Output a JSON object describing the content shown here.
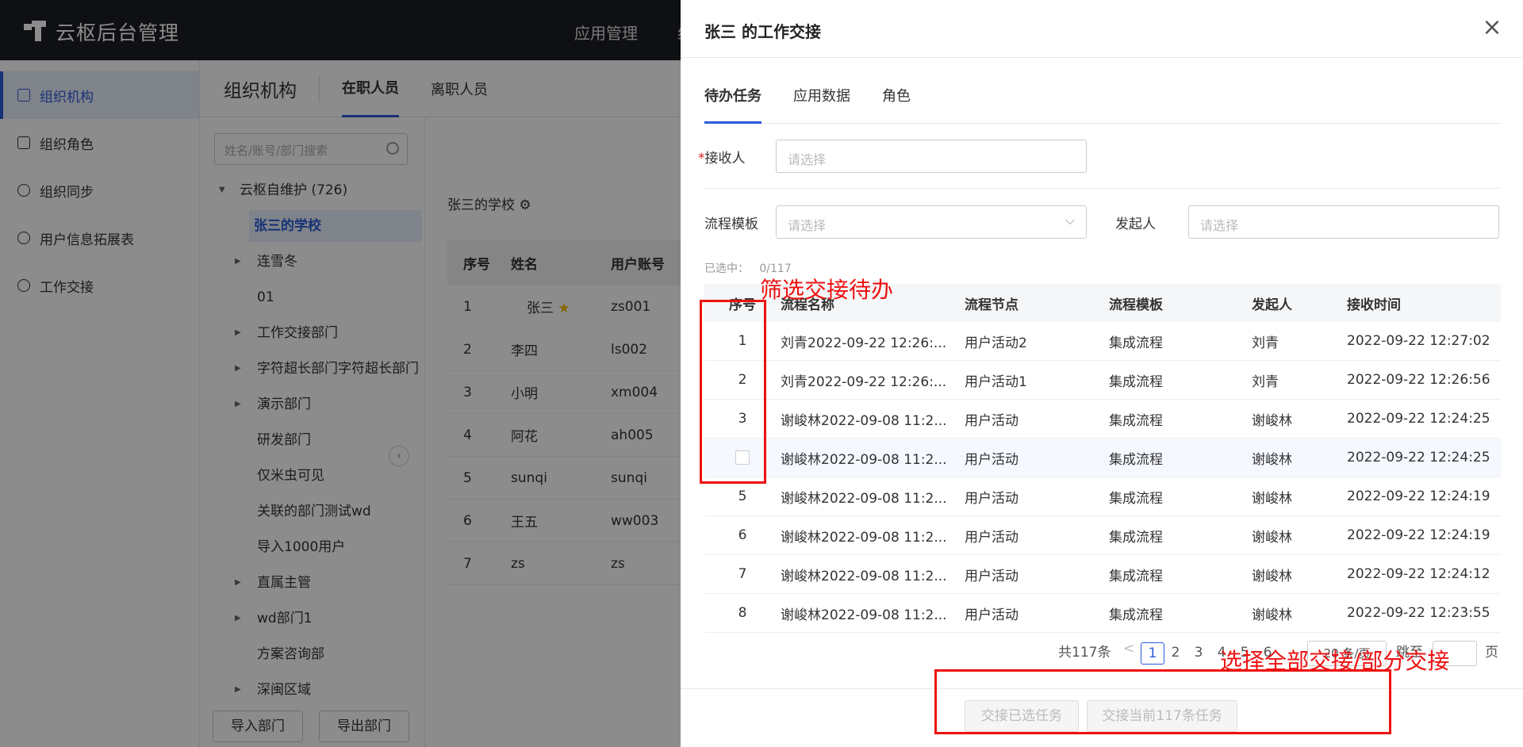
{
  "app": {
    "title": "云枢后台管理",
    "nav_items": [
      "应用管理",
      "组"
    ]
  },
  "sidebar": {
    "items": [
      {
        "label": "组织机构",
        "icon": "org-icon",
        "active": true
      },
      {
        "label": "组织角色",
        "icon": "role-icon"
      },
      {
        "label": "组织同步",
        "icon": "sync-icon"
      },
      {
        "label": "用户信息拓展表",
        "icon": "user-icon"
      },
      {
        "label": "工作交接",
        "icon": "handover-icon"
      }
    ]
  },
  "org": {
    "title": "组织机构",
    "tabs": [
      "在职人员",
      "离职人员"
    ],
    "search_placeholder": "姓名/账号/部门搜索",
    "tree": [
      {
        "label": "云枢自维护 (726)",
        "expand": "open"
      },
      {
        "label": "张三的学校",
        "selected": true
      },
      {
        "label": "连雪冬",
        "expand": "closed"
      },
      {
        "label": "01"
      },
      {
        "label": "工作交接部门",
        "expand": "closed"
      },
      {
        "label": "字符超长部门字符超长部门",
        "expand": "closed"
      },
      {
        "label": "演示部门",
        "expand": "closed"
      },
      {
        "label": "研发部门"
      },
      {
        "label": "仅米虫可见"
      },
      {
        "label": "关联的部门测试wd"
      },
      {
        "label": "导入1000用户"
      },
      {
        "label": "直属主管",
        "expand": "closed"
      },
      {
        "label": "wd部门1",
        "expand": "closed"
      },
      {
        "label": "方案咨询部"
      },
      {
        "label": "深闽区域",
        "expand": "closed"
      }
    ],
    "import_btn": "导入部门",
    "export_btn": "导出部门",
    "school_label": "张三的学校",
    "members": {
      "headers": [
        "序号",
        "姓名",
        "用户账号"
      ],
      "rows": [
        [
          "1",
          "张三",
          "zs001"
        ],
        [
          "2",
          "李四",
          "ls002"
        ],
        [
          "3",
          "小明",
          "xm004"
        ],
        [
          "4",
          "阿花",
          "ah005"
        ],
        [
          "5",
          "sunqi",
          "sunqi"
        ],
        [
          "6",
          "王五",
          "ww003"
        ],
        [
          "7",
          "zs",
          "zs"
        ]
      ]
    }
  },
  "drawer": {
    "title": "张三 的工作交接",
    "tabs": [
      "待办任务",
      "应用数据",
      "角色"
    ],
    "receiver_label": "接收人",
    "receiver_required": "*",
    "receiver_placeholder": "请选择",
    "template_label": "流程模板",
    "template_placeholder": "请选择",
    "initiator_label": "发起人",
    "initiator_placeholder": "请选择",
    "selected_count_label": "已选中：",
    "selected_count": "0/117",
    "table": {
      "headers": [
        "序号",
        "流程名称",
        "流程节点",
        "流程模板",
        "发起人",
        "接收时间"
      ],
      "rows": [
        [
          "1",
          "刘青2022-09-22 12:26:...",
          "用户活动2",
          "集成流程",
          "刘青",
          "2022-09-22 12:27:02"
        ],
        [
          "2",
          "刘青2022-09-22 12:26:...",
          "用户活动1",
          "集成流程",
          "刘青",
          "2022-09-22 12:26:56"
        ],
        [
          "3",
          "谢峻林2022-09-08 11:2...",
          "用户活动",
          "集成流程",
          "谢峻林",
          "2022-09-22 12:24:25"
        ],
        [
          "",
          "谢峻林2022-09-08 11:2...",
          "用户活动",
          "集成流程",
          "谢峻林",
          "2022-09-22 12:24:25"
        ],
        [
          "5",
          "谢峻林2022-09-08 11:2...",
          "用户活动",
          "集成流程",
          "谢峻林",
          "2022-09-22 12:24:19"
        ],
        [
          "6",
          "谢峻林2022-09-08 11:2...",
          "用户活动",
          "集成流程",
          "谢峻林",
          "2022-09-22 12:24:19"
        ],
        [
          "7",
          "谢峻林2022-09-08 11:2...",
          "用户活动",
          "集成流程",
          "谢峻林",
          "2022-09-22 12:24:12"
        ],
        [
          "8",
          "谢峻林2022-09-08 11:2...",
          "用户活动",
          "集成流程",
          "谢峻林",
          "2022-09-22 12:23:55"
        ]
      ]
    },
    "pagination": {
      "total": "共117条",
      "prev": "<",
      "pages": [
        "1",
        "2",
        "3",
        "4",
        "5",
        "6"
      ],
      "current": "1",
      "page_size": "20 条/页",
      "jump_label": "跳至",
      "page_suffix": "页"
    },
    "btn_transfer_selected": "交接已选任务",
    "btn_transfer_all": "交接当前117条任务",
    "close": "×"
  },
  "annotations": {
    "filter_note": "筛选交接待办",
    "select_note": "选择全部交接/部分交接",
    "color": "#ee1111"
  }
}
